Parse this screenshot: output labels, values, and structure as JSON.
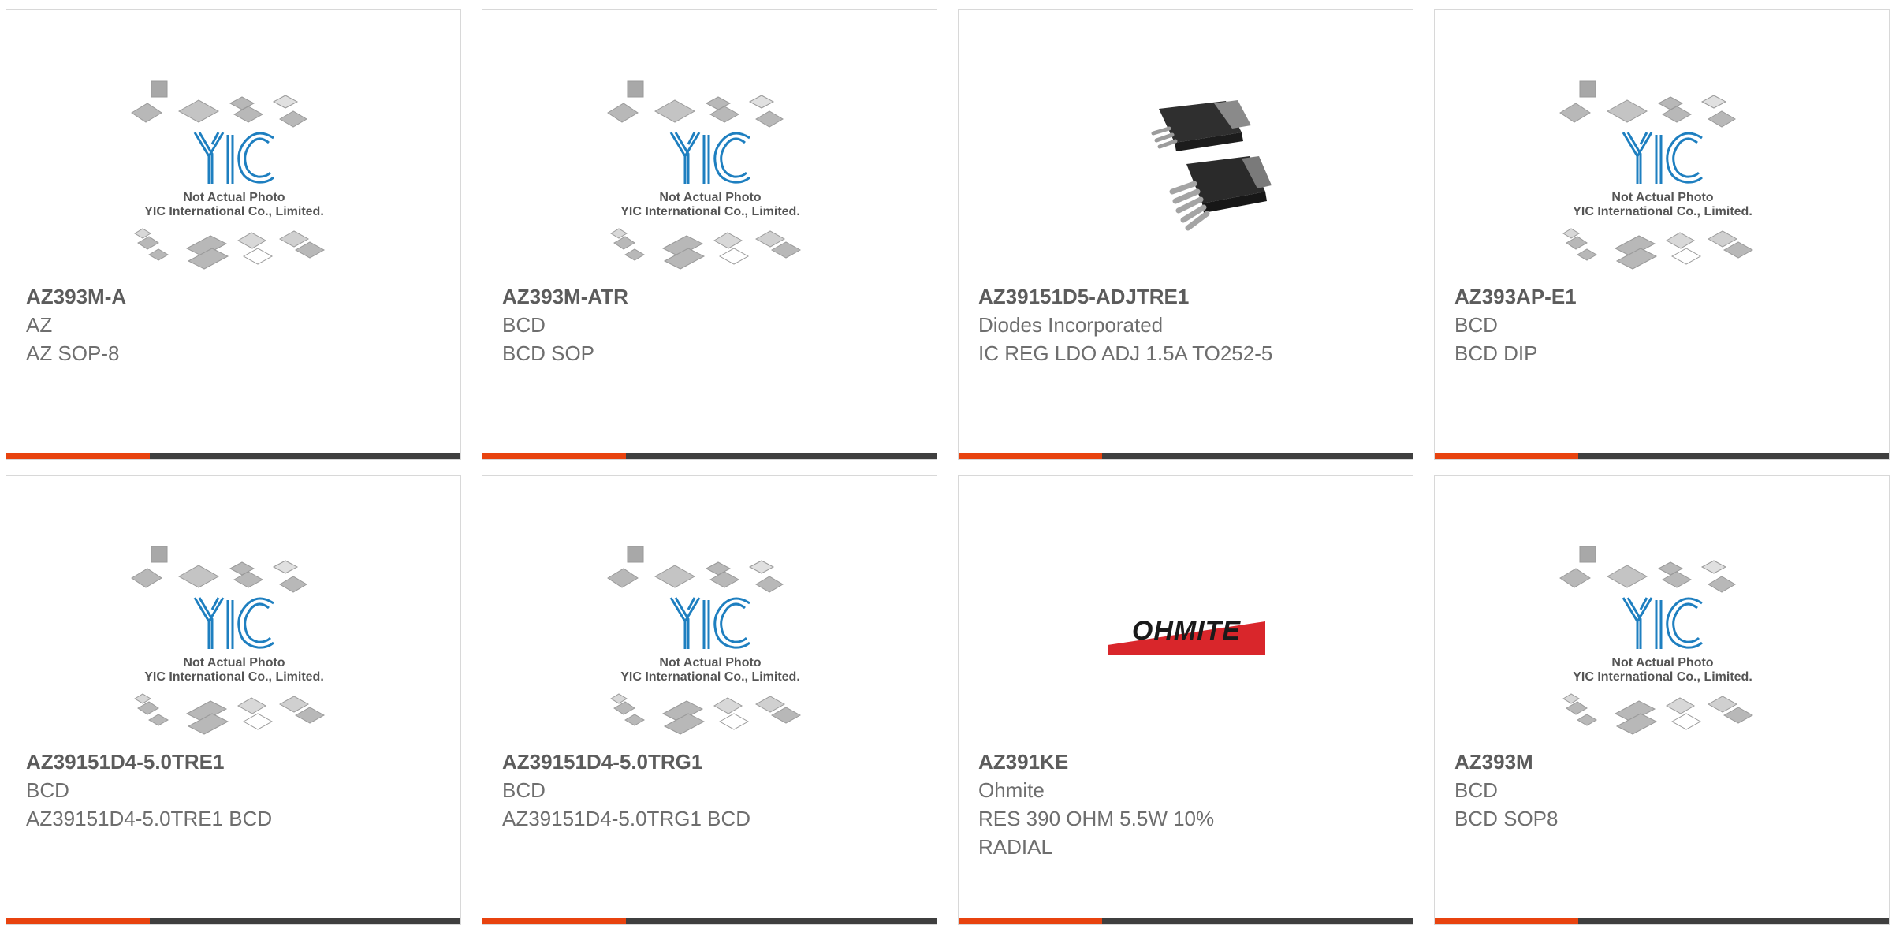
{
  "products": [
    {
      "part_number": "AZ393M-A",
      "manufacturer": "AZ",
      "description": "AZ SOP-8",
      "image": "yic-placeholder",
      "placeholder_line1": "Not Actual Photo",
      "placeholder_line2": "YIC International Co., Limited.",
      "placeholder_logo": "YIC"
    },
    {
      "part_number": "AZ393M-ATR",
      "manufacturer": "BCD",
      "description": "BCD SOP",
      "image": "yic-placeholder",
      "placeholder_line1": "Not Actual Photo",
      "placeholder_line2": "YIC International Co., Limited.",
      "placeholder_logo": "YIC"
    },
    {
      "part_number": "AZ39151D5-ADJTRE1",
      "manufacturer": "Diodes Incorporated",
      "description": "IC REG LDO ADJ 1.5A TO252-5",
      "image": "to252-package-photo"
    },
    {
      "part_number": "AZ393AP-E1",
      "manufacturer": "BCD",
      "description": "BCD DIP",
      "image": "yic-placeholder",
      "placeholder_line1": "Not Actual Photo",
      "placeholder_line2": "YIC International Co., Limited.",
      "placeholder_logo": "YIC"
    },
    {
      "part_number": "AZ39151D4-5.0TRE1",
      "manufacturer": "BCD",
      "description": "AZ39151D4-5.0TRE1 BCD",
      "image": "yic-placeholder",
      "placeholder_line1": "Not Actual Photo",
      "placeholder_line2": "YIC International Co., Limited.",
      "placeholder_logo": "YIC"
    },
    {
      "part_number": "AZ39151D4-5.0TRG1",
      "manufacturer": "BCD",
      "description": "AZ39151D4-5.0TRG1 BCD",
      "image": "yic-placeholder",
      "placeholder_line1": "Not Actual Photo",
      "placeholder_line2": "YIC International Co., Limited.",
      "placeholder_logo": "YIC"
    },
    {
      "part_number": "AZ391KE",
      "manufacturer": "Ohmite",
      "description_line1": "RES 390 OHM 5.5W 10%",
      "description_line2": "RADIAL",
      "image": "ohmite-logo",
      "logo_text": "OHMITE"
    },
    {
      "part_number": "AZ393M",
      "manufacturer": "BCD",
      "description": "BCD SOP8",
      "image": "yic-placeholder",
      "placeholder_line1": "Not Actual Photo",
      "placeholder_line2": "YIC International Co., Limited.",
      "placeholder_logo": "YIC"
    }
  ],
  "colors": {
    "accent_bar": "#e8430f",
    "base_bar": "#3f3f3f",
    "yic_blue": "#1e7fc0",
    "ohmite_red": "#d9262b"
  }
}
